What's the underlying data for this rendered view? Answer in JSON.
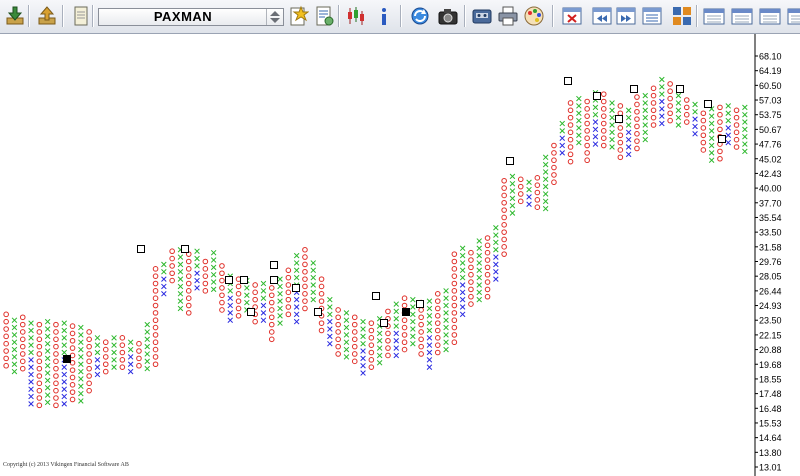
{
  "toolbar": {
    "symbol": "PAXMAN",
    "buttons": [
      {
        "name": "import-icon",
        "kind": "arrow-down"
      },
      {
        "name": "export-icon",
        "kind": "arrow-up"
      },
      {
        "name": "notes-icon",
        "kind": "doc"
      },
      {
        "name": "favorite-icon",
        "kind": "star-doc"
      },
      {
        "name": "report-icon",
        "kind": "doc-lines"
      },
      {
        "name": "candlestick-icon",
        "kind": "candles"
      },
      {
        "name": "info-icon",
        "kind": "info"
      },
      {
        "name": "refresh-icon",
        "kind": "refresh"
      },
      {
        "name": "camera-icon",
        "kind": "camera"
      },
      {
        "name": "cassette-icon",
        "kind": "cassette"
      },
      {
        "name": "print-icon",
        "kind": "printer"
      },
      {
        "name": "palette-icon",
        "kind": "palette"
      },
      {
        "name": "delete-window-icon",
        "kind": "win-x"
      },
      {
        "name": "rewind-window-icon",
        "kind": "win-rew"
      },
      {
        "name": "forward-window-icon",
        "kind": "win-fwd"
      },
      {
        "name": "list-window-icon",
        "kind": "win-list"
      },
      {
        "name": "grid-view-icon",
        "kind": "grid4"
      },
      {
        "name": "daily-calendar-icon",
        "kind": "cal"
      },
      {
        "name": "weekly-calendar-icon",
        "kind": "cal"
      },
      {
        "name": "monthly-calendar-icon",
        "kind": "cal"
      },
      {
        "name": "yearly-calendar-icon",
        "kind": "cal"
      }
    ]
  },
  "copyright": "Copyright (c) 2013 Vikingen Financial Software AB",
  "colors": {
    "up_x": "#2db82d",
    "down_o": "#e0302a",
    "flat_x": "#2a2ae0",
    "axis": "#000000"
  },
  "chart_data": {
    "type": "point-and-figure",
    "y_axis_ticks": [
      "68.10",
      "64.19",
      "60.50",
      "57.03",
      "53.75",
      "50.67",
      "47.76",
      "45.02",
      "42.43",
      "40.00",
      "37.70",
      "35.54",
      "33.50",
      "31.58",
      "29.76",
      "28.05",
      "26.44",
      "24.93",
      "23.50",
      "22.15",
      "20.88",
      "19.68",
      "18.55",
      "17.48",
      "16.48",
      "15.53",
      "14.64",
      "13.80",
      "13.01"
    ],
    "column_heights_in_ticks": [
      [
        4,
        9
      ],
      [
        1,
        7
      ],
      [
        3,
        8
      ],
      [
        3,
        10
      ],
      [
        8,
        15
      ],
      [
        8,
        11
      ],
      [
        10,
        17
      ],
      [
        7,
        11
      ],
      [
        8,
        14
      ],
      [
        2,
        9
      ],
      [
        10,
        17
      ],
      [
        5,
        14
      ],
      [
        9,
        14
      ],
      [
        2,
        11
      ],
      [
        11,
        19
      ],
      [
        6,
        18
      ],
      [
        11,
        30
      ],
      [
        24,
        40
      ],
      [
        23,
        42
      ],
      [
        33,
        48
      ],
      [
        37,
        44
      ],
      [
        32,
        46
      ]
    ],
    "markers": [
      {
        "col": 20,
        "tick": [
          3,
          3
        ],
        "filled": true
      },
      {
        "col": 47,
        "tick": [
          22,
          22
        ],
        "filled": false
      }
    ]
  }
}
